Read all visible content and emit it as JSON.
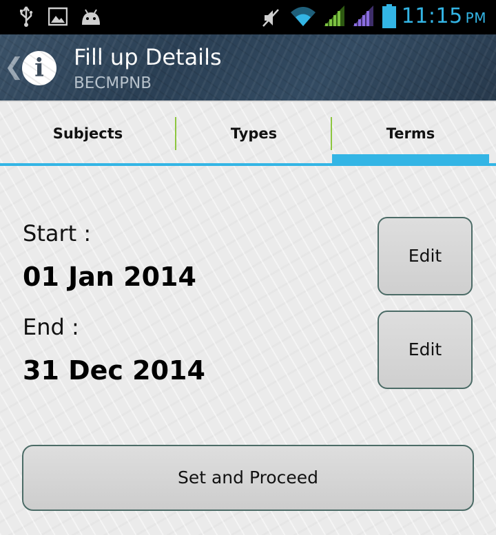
{
  "status_bar": {
    "time": "11:15",
    "ampm": "PM",
    "icons": [
      "usb-icon",
      "image-icon",
      "android-icon",
      "mute-icon",
      "wifi-icon",
      "signal-1-icon",
      "signal-2-icon",
      "battery-icon"
    ],
    "accent": "#33b5e5"
  },
  "action_bar": {
    "title": "Fill up Details",
    "subtitle": "BECMPNB"
  },
  "tabs": [
    {
      "label": "Subjects",
      "selected": false
    },
    {
      "label": "Types",
      "selected": false
    },
    {
      "label": "Terms",
      "selected": true
    }
  ],
  "terms": {
    "start_label": "Start :",
    "start_date": "01 Jan 2014",
    "end_label": "End :",
    "end_date": "31 Dec 2014",
    "edit_label": "Edit"
  },
  "proceed_label": "Set and Proceed",
  "colors": {
    "tab_accent": "#33b5e5",
    "tab_divider": "#8dc63f",
    "button_border": "#4b6b66"
  }
}
